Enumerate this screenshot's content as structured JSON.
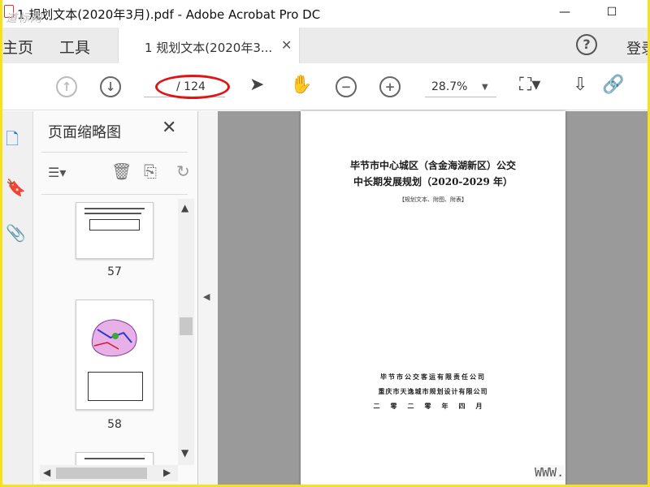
{
  "window": {
    "title": "1 规划文本(2020年3月).pdf - Adobe Acrobat Pro DC",
    "watermark": "道标网",
    "minimize": "—",
    "maximize": "☐"
  },
  "tabs": {
    "home": "主页",
    "tools": "工具",
    "document": "1 规划文本(2020年3...",
    "close": "✕",
    "help": "?",
    "login": "登录"
  },
  "toolbar": {
    "page_input": "",
    "page_total": "/ 124",
    "zoom": "28.7%"
  },
  "thumbnail_panel": {
    "title": "页面缩略图",
    "close": "✕",
    "pages": [
      {
        "label": "57"
      },
      {
        "label": "58"
      }
    ]
  },
  "document_page": {
    "title_line1": "毕节市中心城区（含金海湖新区）公交",
    "title_line2": "中长期发展规划（2020-2029 年）",
    "subtitle": "【规划文本、附图、附表】",
    "org_line1": "毕节市公交客运有限责任公司",
    "org_line2": "重庆市天逸城市规划设计有限公司",
    "date_line": "二零二零年四月"
  },
  "overlay": {
    "www": "WWW."
  },
  "colors": {
    "accent": "#1473e6",
    "annotation": "#e01414",
    "frame": "#f5e21a",
    "doc_background": "#9a9a9a"
  }
}
